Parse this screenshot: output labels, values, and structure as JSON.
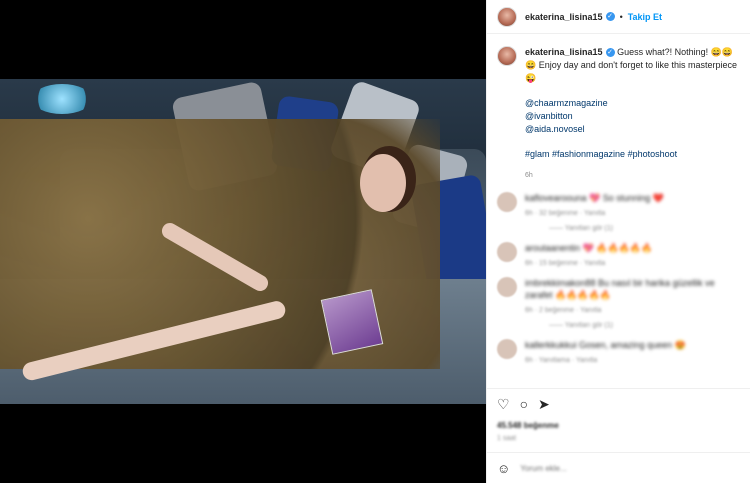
{
  "post": {
    "username": "ekaterina_lisina15",
    "follow_label": "Takip Et",
    "caption_text": "Guess what?! Nothing! 😄😄😄 Enjoy day and don't forget to like this masterpiece 😜",
    "mentions": [
      "@chaarmzmagazine",
      "@ivanbitton",
      "@aida.novosel"
    ],
    "tags": "#glam #fashionmagazine #photoshoot",
    "time_ago": "6h"
  },
  "comments": [
    {
      "text": "kaflovearoouna 💖 So stunning ❤️",
      "meta": "6h · 32 beğenme · Yanıtla",
      "replies": "—— Yanıtları gör (1)"
    },
    {
      "text": "aroutaanentin 💖 🔥🔥🔥🔥🔥",
      "meta": "6h · 15 beğenme · Yanıtla",
      "replies": ""
    },
    {
      "text": "imbrekkimakon88 Bu nasıl bir harika güzellik ve zarafet 🔥🔥🔥🔥🔥",
      "meta": "6h · 2 beğenme · Yanıtla",
      "replies": "—— Yanıtları gör (1)"
    },
    {
      "text": "kallerkkukkui Gosen, amazing queen 😍",
      "meta": "6h · Yanıtlama · Yanıtla",
      "replies": ""
    }
  ],
  "actions": {
    "like_icon": "heart-icon",
    "comment_icon": "comment-icon",
    "share_icon": "share-icon",
    "likes_text": "45.548 beğenme",
    "posted_text": "1 saat"
  },
  "add_comment": {
    "emoji_icon": "smile-icon",
    "placeholder": "Yorum ekle..."
  }
}
